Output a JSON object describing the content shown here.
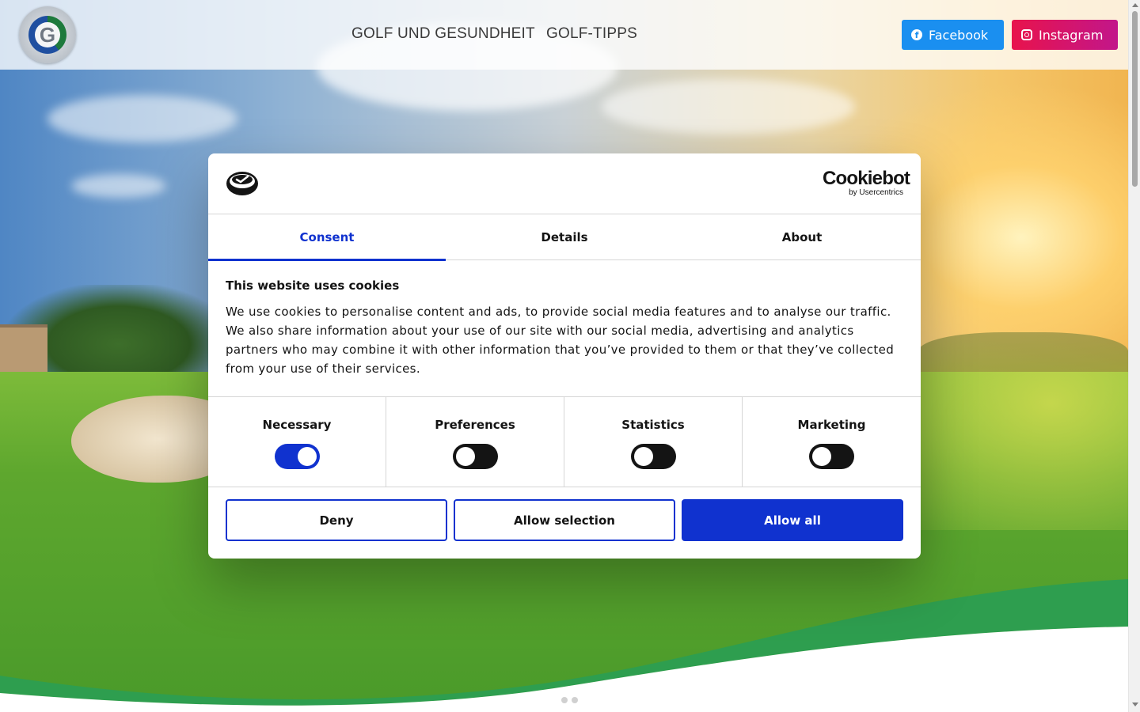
{
  "header": {
    "logo_text": "G",
    "nav": [
      "GOLF UND GESUNDHEIT",
      "GOLF-TIPPS"
    ],
    "facebook_label": "Facebook",
    "instagram_label": "Instagram",
    "facebook_icon": "facebook-icon",
    "instagram_icon": "instagram-icon"
  },
  "cookie_dialog": {
    "brand_logo": "Cookiebot",
    "brand_sub": "by Usercentrics",
    "tabs": [
      "Consent",
      "Details",
      "About"
    ],
    "active_tab": "Consent",
    "title": "This website uses cookies",
    "body": "We use cookies to personalise content and ads, to provide social media features and to analyse our traffic. We also share information about your use of our site with our social media, advertising and analytics partners who may combine it with other information that you’ve provided to them or that they’ve collected from your use of their services.",
    "toggles": [
      {
        "label": "Necessary",
        "on": true
      },
      {
        "label": "Preferences",
        "on": false
      },
      {
        "label": "Statistics",
        "on": false
      },
      {
        "label": "Marketing",
        "on": false
      }
    ],
    "buttons": {
      "deny": "Deny",
      "allow_selection": "Allow selection",
      "allow_all": "Allow all"
    }
  },
  "colors": {
    "accent": "#1032cf",
    "facebook": "#1a8ff0",
    "instagram": "#e8134c",
    "wave_green": "#2e9e4f"
  }
}
